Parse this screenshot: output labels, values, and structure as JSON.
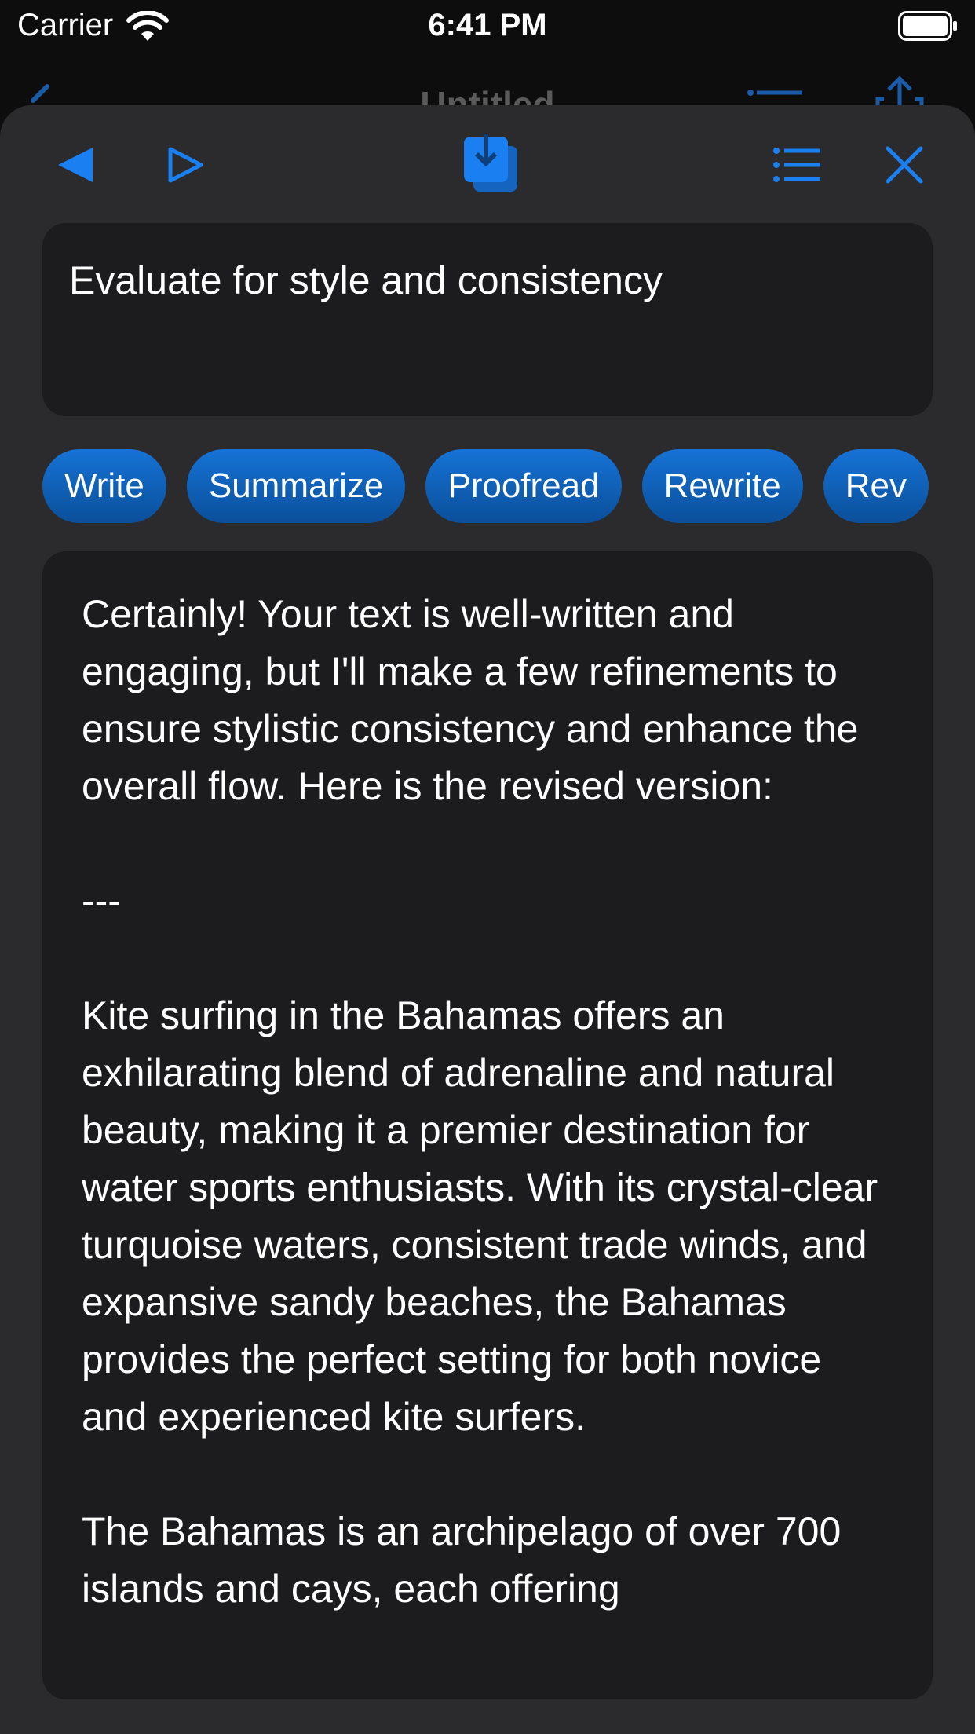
{
  "status_bar": {
    "carrier": "Carrier",
    "time": "6:41 PM"
  },
  "background_nav": {
    "title": "Untitled"
  },
  "toolbar": {
    "icons": [
      "back-triangle-icon",
      "forward-triangle-icon",
      "save-download-icon",
      "list-icon",
      "close-icon"
    ],
    "accent_color": "#1a7ff0"
  },
  "prompt": {
    "text": "Evaluate for style and consistency"
  },
  "actions": [
    {
      "label": "Write"
    },
    {
      "label": "Summarize"
    },
    {
      "label": "Proofread"
    },
    {
      "label": "Rewrite"
    },
    {
      "label": "Rev"
    }
  ],
  "result": {
    "paragraphs": [
      "Certainly! Your text is well-written and engaging, but I'll make a few refinements to ensure stylistic consistency and enhance the overall flow. Here is the revised version:",
      "---",
      "Kite surfing in the Bahamas offers an exhilarating blend of adrenaline and natural beauty, making it a premier destination for water sports enthusiasts. With its crystal-clear turquoise waters, consistent trade winds, and expansive sandy beaches, the Bahamas provides the perfect setting for both novice and experienced kite surfers.",
      "The Bahamas is an archipelago of over 700 islands and cays, each offering"
    ]
  }
}
